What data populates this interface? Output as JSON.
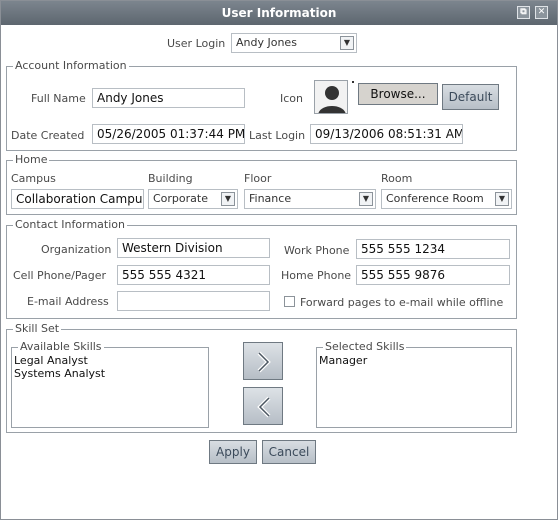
{
  "window": {
    "title": "User Information",
    "restore_glyph": "⧉",
    "close_glyph": "✕"
  },
  "user_login": {
    "label": "User Login",
    "value": "Andy Jones"
  },
  "account": {
    "legend": "Account Information",
    "full_name_label": "Full Name",
    "full_name": "Andy Jones",
    "icon_label": "Icon",
    "browse_label": "Browse...",
    "default_label": "Default",
    "date_created_label": "Date Created",
    "date_created": "05/26/2005 01:37:44 PM",
    "last_login_label": "Last Login",
    "last_login": "09/13/2006 08:51:31 AM"
  },
  "home": {
    "legend": "Home",
    "campus_label": "Campus",
    "campus": "Collaboration Campus",
    "building_label": "Building",
    "building": "Corporate",
    "floor_label": "Floor",
    "floor": "Finance",
    "room_label": "Room",
    "room": "Conference Room"
  },
  "contact": {
    "legend": "Contact Information",
    "organization_label": "Organization",
    "organization": "Western Division",
    "work_phone_label": "Work Phone",
    "work_phone": "555 555 1234",
    "cell_phone_label": "Cell Phone/Pager",
    "cell_phone": "555 555 4321",
    "home_phone_label": "Home Phone",
    "home_phone": "555 555 9876",
    "email_label": "E-mail Address",
    "email": "",
    "forward_label": "Forward pages to e-mail while offline",
    "forward_checked": false
  },
  "skills": {
    "legend": "Skill Set",
    "available_label": "Available Skills",
    "available": [
      "Legal Analyst",
      "Systems Analyst"
    ],
    "selected_label": "Selected Skills",
    "selected": [
      "Manager"
    ]
  },
  "footer": {
    "apply_label": "Apply",
    "cancel_label": "Cancel"
  },
  "icons": {
    "dropdown": "chevron-down-icon",
    "avatar": "user-silhouette-icon"
  }
}
